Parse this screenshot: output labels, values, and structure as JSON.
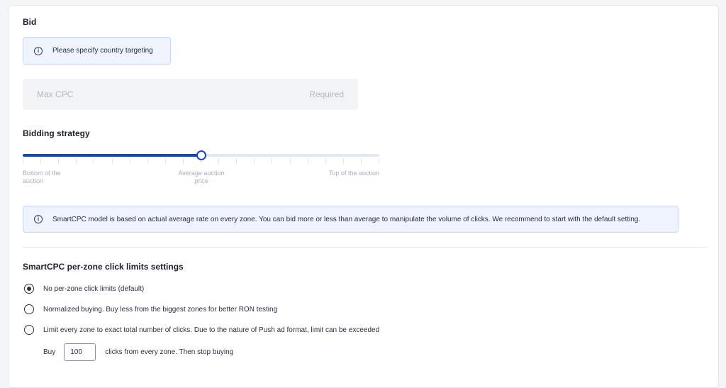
{
  "bid": {
    "title": "Bid",
    "country_notice": "Please specify country targeting",
    "max_cpc_placeholder": "Max CPC",
    "max_cpc_value": "",
    "required_label": "Required"
  },
  "bidding_strategy": {
    "title": "Bidding strategy",
    "slider_level_fraction": 0.5,
    "tick_count": 21,
    "labels": {
      "left": "Bottom of the auction",
      "center": "Average auction price",
      "right": "Top of the auction"
    },
    "info_text": "SmartCPC model is based on actual average rate on every zone. You can bid more or less than average to manipulate the volume of clicks. We recommend to start with the default setting."
  },
  "click_limits": {
    "title": "SmartCPC per-zone click limits settings",
    "options": [
      {
        "label": "No per-zone click limits (default)",
        "checked": true
      },
      {
        "label": "Normalized buying. Buy less from the biggest zones for better RON testing",
        "checked": false
      },
      {
        "label": "Limit every zone to exact total number of clicks. Due to the nature of Push ad format, limit can be exceeded",
        "checked": false
      }
    ],
    "buy_prefix": "Buy",
    "buy_value": "100",
    "buy_suffix": "clicks from every zone. Then stop buying"
  },
  "colors": {
    "accent": "#1747c9",
    "info_bg": "#eef3fd",
    "info_border": "#c6d6f6"
  },
  "icons": {
    "info": "info-circle-icon",
    "info_glyph": "i"
  }
}
